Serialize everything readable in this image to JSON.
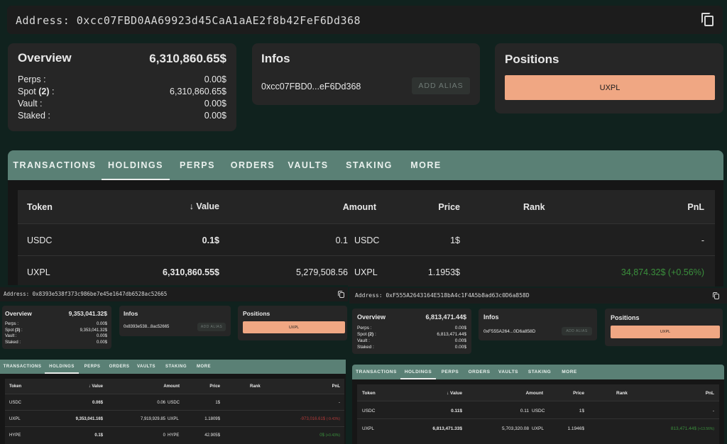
{
  "main": {
    "address_label": "Address:",
    "address": "0xcc07FBD0AA69923d45CaA1aAE2f8b42FeF6Dd368",
    "overview": {
      "title": "Overview",
      "total": "6,310,860.65$",
      "rows": [
        {
          "label": "Perps :",
          "value": "0.00$"
        },
        {
          "label": "Spot",
          "count": "(2)",
          "suffix": " :",
          "value": "6,310,860.65$"
        },
        {
          "label": "Vault :",
          "value": "0.00$"
        },
        {
          "label": "Staked :",
          "value": "0.00$"
        }
      ]
    },
    "infos": {
      "title": "Infos",
      "short_address": "0xcc07FBD0...eF6Dd368",
      "add_alias": "ADD ALIAS"
    },
    "positions": {
      "title": "Positions",
      "token": "UXPL"
    },
    "tabs": [
      "TRANSACTIONS",
      "HOLDINGS",
      "PERPS",
      "ORDERS",
      "VAULTS",
      "STAKING",
      "MORE"
    ],
    "table": {
      "headers": {
        "token": "Token",
        "value": "Value",
        "amount": "Amount",
        "price": "Price",
        "rank": "Rank",
        "pnl": "PnL"
      },
      "rows": [
        {
          "token": "USDC",
          "value": "0.1$",
          "amount": "0.1",
          "unit": "USDC",
          "price": "1$",
          "rank": "",
          "pnl": "-",
          "pnl_pct": ""
        },
        {
          "token": "UXPL",
          "value": "6,310,860.55$",
          "amount": "5,279,508.56",
          "unit": "UXPL",
          "price": "1.1953$",
          "rank": "",
          "pnl": "34,874.32$",
          "pnl_pct": "(+0.56%)"
        }
      ]
    }
  },
  "left": {
    "address_label": "Address:",
    "address": "0x8393e538f373c986be7e45e1647db6528ac52665",
    "overview": {
      "title": "Overview",
      "total": "9,353,041.32$",
      "rows": [
        {
          "label": "Perps :",
          "value": "0.00$"
        },
        {
          "label": "Spot",
          "count": "(3)",
          "suffix": " :",
          "value": "9,353,041.32$"
        },
        {
          "label": "Vault :",
          "value": "0.00$"
        },
        {
          "label": "Staked :",
          "value": "0.00$"
        }
      ]
    },
    "infos": {
      "title": "Infos",
      "short_address": "0x8393e538...8ac52665",
      "add_alias": "ADD ALIAS"
    },
    "positions": {
      "title": "Positions",
      "token": "UXPL"
    },
    "tabs": [
      "TRANSACTIONS",
      "HOLDINGS",
      "PERPS",
      "ORDERS",
      "VAULTS",
      "STAKING",
      "MORE"
    ],
    "table": {
      "headers": {
        "token": "Token",
        "value": "Value",
        "amount": "Amount",
        "price": "Price",
        "rank": "Rank",
        "pnl": "PnL"
      },
      "rows": [
        {
          "token": "USDC",
          "value": "0.06$",
          "amount": "0.06",
          "unit": "USDC",
          "price": "1$",
          "pnl": "-",
          "pnl_pct": ""
        },
        {
          "token": "UXPL",
          "value": "9,353,041.16$",
          "amount": "7,919,929.85",
          "unit": "UXPL",
          "price": "1.1809$",
          "pnl": "-973,016.61$",
          "pnl_pct": "(-9.43%)"
        },
        {
          "token": "HYPE",
          "value": "0.1$",
          "amount": "0",
          "unit": "HYPE",
          "price": "42.905$",
          "pnl": "0$",
          "pnl_pct": "(+0.43%)"
        }
      ]
    }
  },
  "right": {
    "address_label": "Address:",
    "address": "0xF555A2643164E518bA4c1F4A5b8ad63c0D6a858D",
    "overview": {
      "title": "Overview",
      "total": "6,813,471.44$",
      "rows": [
        {
          "label": "Perps :",
          "value": "0.00$"
        },
        {
          "label": "Spot",
          "count": "(2)",
          "suffix": " :",
          "value": "6,813,471.44$"
        },
        {
          "label": "Vault :",
          "value": "0.00$"
        },
        {
          "label": "Staked :",
          "value": "0.00$"
        }
      ]
    },
    "infos": {
      "title": "Infos",
      "short_address": "0xF555A264...0D6a858D",
      "add_alias": "ADD ALIAS"
    },
    "positions": {
      "title": "Positions",
      "token": "UXPL"
    },
    "tabs": [
      "TRANSACTIONS",
      "HOLDINGS",
      "PERPS",
      "ORDERS",
      "VAULTS",
      "STAKING",
      "MORE"
    ],
    "table": {
      "headers": {
        "token": "Token",
        "value": "Value",
        "amount": "Amount",
        "price": "Price",
        "rank": "Rank",
        "pnl": "PnL"
      },
      "rows": [
        {
          "token": "USDC",
          "value": "0.11$",
          "amount": "0.11",
          "unit": "USDC",
          "price": "1$",
          "pnl": "-",
          "pnl_pct": ""
        },
        {
          "token": "UXPL",
          "value": "6,813,471.33$",
          "amount": "5,703,320.08",
          "unit": "UXPL",
          "price": "1.1946$",
          "pnl": "813,471.44$",
          "pnl_pct": "(+13.56%)"
        }
      ]
    }
  },
  "colors": {
    "background": "#10221e",
    "card": "#262626",
    "tab_bar": "#5a8075",
    "accent": "#f0a783",
    "profit": "#3a8f3c",
    "loss": "#b13a3a"
  },
  "icons": {
    "copy": "copy-icon",
    "sort": "arrow-down-icon"
  }
}
